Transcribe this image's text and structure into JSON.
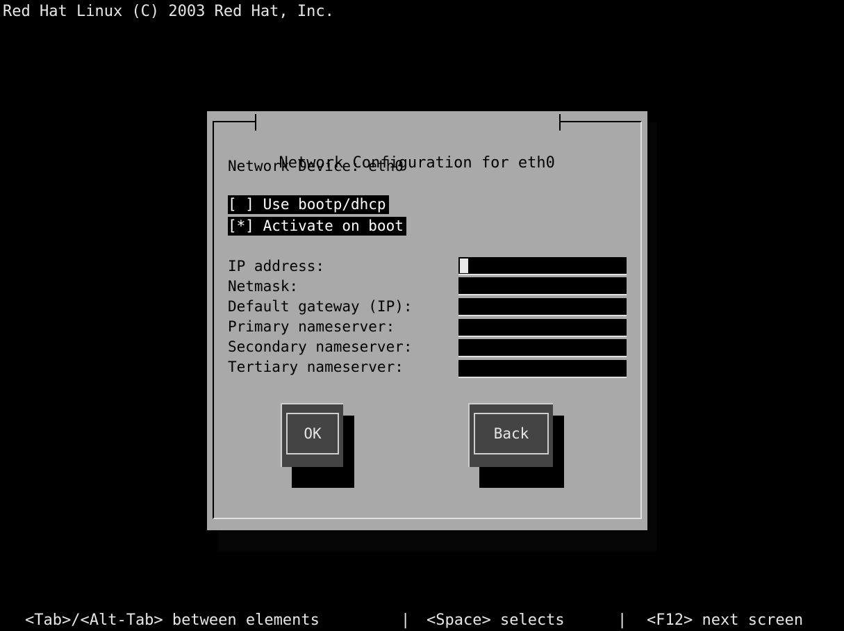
{
  "screen": {
    "title_line": "Red Hat Linux (C) 2003 Red Hat, Inc."
  },
  "dialog": {
    "title": "Network Configuration for eth0",
    "device_line": "Network Device: eth0",
    "checkboxes": [
      {
        "label": "[ ] Use bootp/dhcp",
        "checked": false
      },
      {
        "label": "[*] Activate on boot",
        "checked": true
      }
    ],
    "fields": [
      {
        "label": "IP address:",
        "value": ""
      },
      {
        "label": "Netmask:",
        "value": ""
      },
      {
        "label": "Default gateway (IP):",
        "value": ""
      },
      {
        "label": "Primary nameserver:",
        "value": ""
      },
      {
        "label": "Secondary nameserver:",
        "value": ""
      },
      {
        "label": "Tertiary nameserver:",
        "value": ""
      }
    ],
    "ok_label": "OK",
    "back_label": "Back"
  },
  "hints": {
    "tab": "<Tab>/<Alt-Tab> between elements",
    "sep1": "|",
    "space": "<Space> selects",
    "sep2": "|",
    "f12": "<F12> next screen"
  },
  "colors": {
    "background": "#000000",
    "dialog": "#a9a9a9",
    "button": "#444444",
    "text_light": "#e6e6e6"
  }
}
